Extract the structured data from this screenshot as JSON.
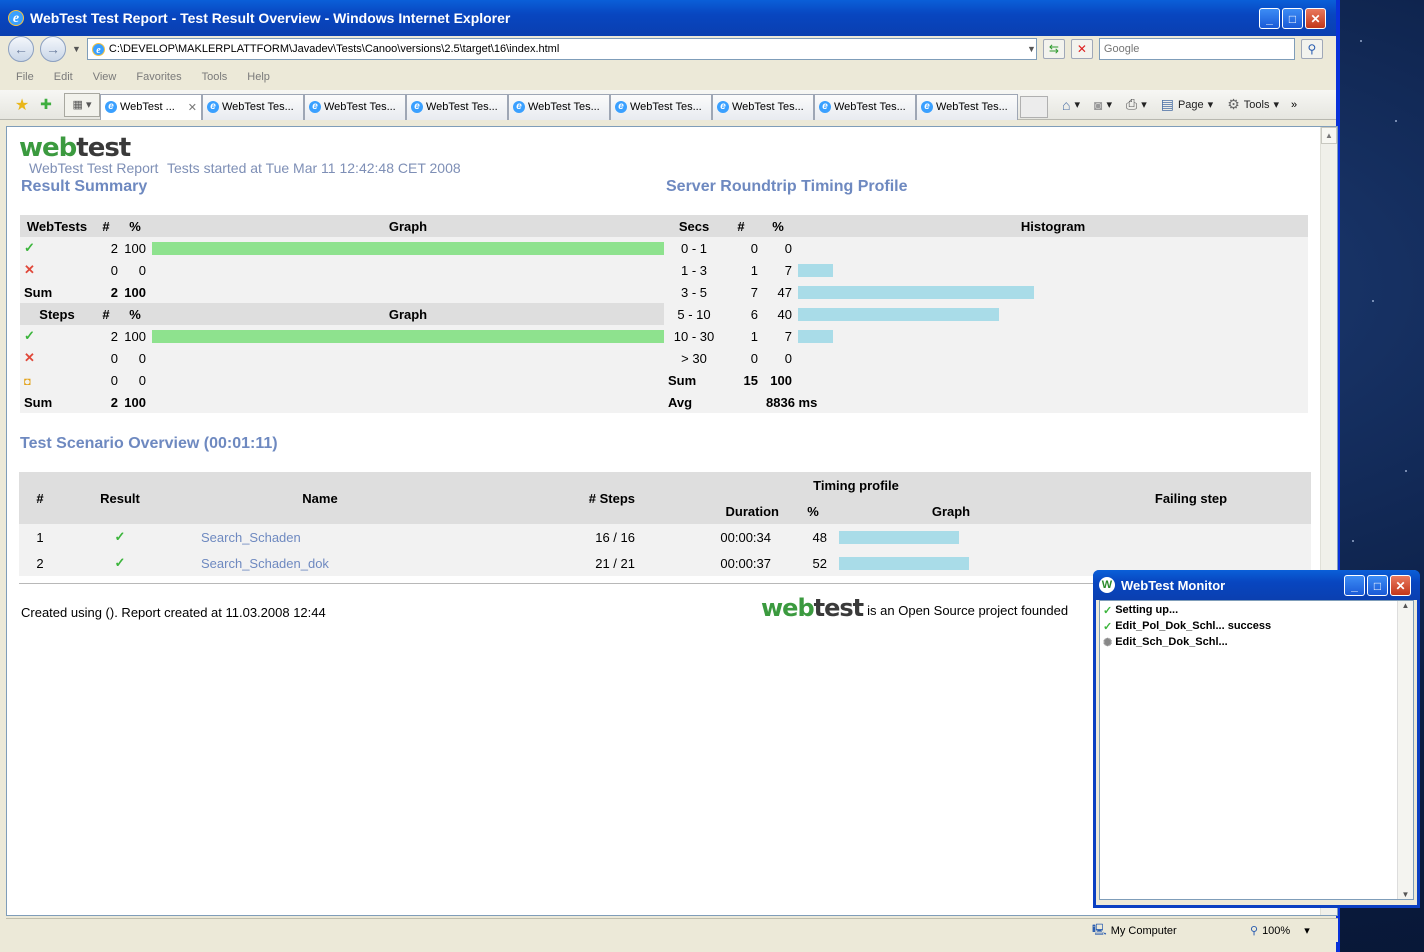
{
  "window": {
    "title": "WebTest Test Report - Test Result Overview - Windows Internet Explorer",
    "address": "C:\\DEVELOP\\MAKLERPLATTFORM\\Javadev\\Tests\\Canoo\\versions\\2.5\\target\\16\\index.html",
    "search_placeholder": "Google"
  },
  "menu": [
    "File",
    "Edit",
    "View",
    "Favorites",
    "Tools",
    "Help"
  ],
  "tabs": [
    {
      "label": "WebTest ...",
      "active": true
    },
    {
      "label": "WebTest Tes..."
    },
    {
      "label": "WebTest Tes..."
    },
    {
      "label": "WebTest Tes..."
    },
    {
      "label": "WebTest Tes..."
    },
    {
      "label": "WebTest Tes..."
    },
    {
      "label": "WebTest Tes..."
    },
    {
      "label": "WebTest Tes..."
    },
    {
      "label": "WebTest Tes..."
    }
  ],
  "commands": {
    "page": "Page",
    "tools": "Tools"
  },
  "report": {
    "logo_web": "web",
    "logo_test": "test",
    "subtitle": "WebTest Test Report",
    "started": "Tests started at Tue Mar 11 12:42:48 CET 2008",
    "result_summary_title": "Result Summary",
    "timing_title": "Server Roundtrip Timing Profile",
    "webtests_headers": [
      "WebTests",
      "#",
      "%",
      "Graph"
    ],
    "webtests_rows": [
      {
        "icon": "success-check-icon",
        "count": "2",
        "pct": "100",
        "bar": 1.0
      },
      {
        "icon": "failure-cross-icon",
        "count": "0",
        "pct": "0",
        "bar": 0
      }
    ],
    "webtests_sum": {
      "label": "Sum",
      "count": "2",
      "pct": "100"
    },
    "steps_headers": [
      "Steps",
      "#",
      "%",
      "Graph"
    ],
    "steps_rows": [
      {
        "icon": "success-check-icon",
        "count": "2",
        "pct": "100",
        "bar": 1.0
      },
      {
        "icon": "failure-cross-icon",
        "count": "0",
        "pct": "0",
        "bar": 0
      },
      {
        "icon": "skipped-circle-icon",
        "count": "0",
        "pct": "0",
        "bar": 0
      }
    ],
    "steps_sum": {
      "label": "Sum",
      "count": "2",
      "pct": "100"
    },
    "timing_headers": [
      "Secs",
      "#",
      "%",
      "Histogram"
    ],
    "timing_rows": [
      {
        "secs": "0 - 1",
        "count": "0",
        "pct": "0",
        "bar": 0
      },
      {
        "secs": "1 - 3",
        "count": "1",
        "pct": "7",
        "bar": 0.07
      },
      {
        "secs": "3 - 5",
        "count": "7",
        "pct": "47",
        "bar": 0.47
      },
      {
        "secs": "5 - 10",
        "count": "6",
        "pct": "40",
        "bar": 0.4
      },
      {
        "secs": "10 - 30",
        "count": "1",
        "pct": "7",
        "bar": 0.07
      },
      {
        "secs": "> 30",
        "count": "0",
        "pct": "0",
        "bar": 0
      }
    ],
    "timing_sum": {
      "label": "Sum",
      "count": "15",
      "pct": "100"
    },
    "timing_avg": {
      "label": "Avg",
      "value": "8836 ms"
    },
    "scenario_title": "Test Scenario Overview (00:01:11)",
    "scenario_headers": {
      "num": "#",
      "result": "Result",
      "name": "Name",
      "steps": "# Steps",
      "timing": "Timing profile",
      "duration": "Duration",
      "pct": "%",
      "graph": "Graph",
      "failing": "Failing step"
    },
    "scenarios": [
      {
        "num": "1",
        "name": "Search_Schaden",
        "steps": "16 / 16",
        "duration": "00:00:34",
        "pct": "48",
        "bar": 0.48
      },
      {
        "num": "2",
        "name": "Search_Schaden_dok",
        "steps": "21 / 21",
        "duration": "00:00:37",
        "pct": "52",
        "bar": 0.52
      }
    ],
    "footer_left": "Created using (). Report created at 11.03.2008 12:44",
    "footer_right": "is an Open Source project founded"
  },
  "status": {
    "zone": "My Computer",
    "zoom": "100%"
  },
  "monitor": {
    "title": "WebTest Monitor",
    "lines": [
      {
        "icon": "success-check-icon",
        "text": "Setting up..."
      },
      {
        "icon": "success-check-icon",
        "text": "Edit_Pol_Dok_Schl... success"
      },
      {
        "icon": "loading-spinner-icon",
        "text": "Edit_Sch_Dok_Schl..."
      }
    ]
  },
  "colors": {
    "pass_bar": "#8ee28e",
    "timing_bar": "#a9dce8",
    "heading": "#6e89c0"
  }
}
